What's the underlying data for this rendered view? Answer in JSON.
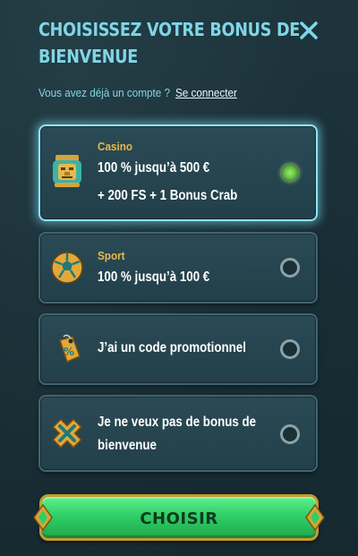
{
  "header": {
    "title": "CHOISISSEZ VOTRE BONUS DE BIENVENUE",
    "close_icon": "close-icon"
  },
  "login": {
    "prompt": "Vous avez déjà un compte ?",
    "link_label": "Se connecter"
  },
  "options": [
    {
      "icon": "aztec-mask-icon",
      "tag": "Casino",
      "lines": [
        "100 % jusqu’à 500 €",
        "+ 200 FS + 1 Bonus Crab"
      ],
      "selected": true
    },
    {
      "icon": "soccer-ball-icon",
      "tag": "Sport",
      "lines": [
        "100 % jusqu’à 100 €"
      ],
      "selected": false
    },
    {
      "icon": "promo-tag-icon",
      "tag": "",
      "lines": [
        "J’ai un code promotionnel"
      ],
      "selected": false
    },
    {
      "icon": "no-bonus-icon",
      "tag": "",
      "lines": [
        "Je ne veux pas de bonus de",
        "bienvenue"
      ],
      "selected": false
    }
  ],
  "cta": {
    "label": "CHOISIR"
  },
  "colors": {
    "accent_cyan": "#7fd6e6",
    "tag_gold": "#e9b84a",
    "cta_green": "#2fcf66",
    "cta_border_gold": "#c79a2e"
  }
}
